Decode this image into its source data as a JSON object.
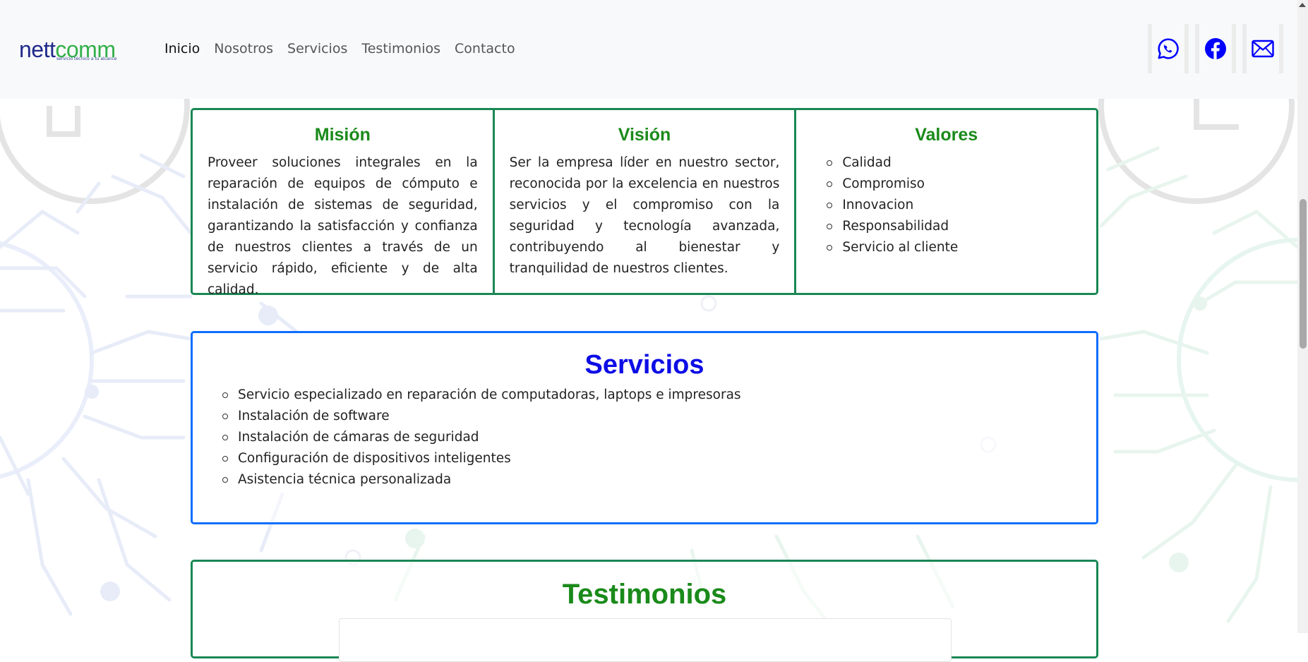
{
  "brand": {
    "logo_text_n": "n",
    "logo_text_e": "e",
    "logo_text_tt": "tt",
    "logo_text_comm": "comm",
    "tagline": "servicio técnico a tu alcance"
  },
  "nav": {
    "items": [
      "Inicio",
      "Nosotros",
      "Servicios",
      "Testimonios",
      "Contacto"
    ]
  },
  "social": {
    "icons": [
      "whatsapp-icon",
      "facebook-icon",
      "envelope-icon"
    ],
    "color": "#0000ff"
  },
  "colors": {
    "green": "#198754",
    "blue_border": "#0d6efd",
    "heading_green": "#1a8a1a",
    "heading_blue": "#0d0de6"
  },
  "mision": {
    "title": "Misión",
    "text": "Proveer soluciones integrales en la reparación de equipos de cómputo e instalación de sistemas de seguridad, garantizando la satisfacción y confianza de nuestros clientes a través de un servicio rápido, eficiente y de alta calidad."
  },
  "vision": {
    "title": "Visión",
    "text": "Ser la empresa líder en nuestro sector, reconocida por la excelencia en nuestros servicios y el compromiso con la seguridad y tecnología avanzada, contribuyendo al bienestar y tranquilidad de nuestros clientes."
  },
  "valores": {
    "title": "Valores",
    "items": [
      "Calidad",
      "Compromiso",
      "Innovacion",
      "Responsabilidad",
      "Servicio al cliente"
    ]
  },
  "servicios": {
    "title": "Servicios",
    "items": [
      "Servicio especializado en reparación de computadoras, laptops e impresoras",
      "Instalación de software",
      "Instalación de cámaras de seguridad",
      "Configuración de dispositivos inteligentes",
      "Asistencia técnica personalizada"
    ]
  },
  "testimonios": {
    "title": "Testimonios"
  }
}
